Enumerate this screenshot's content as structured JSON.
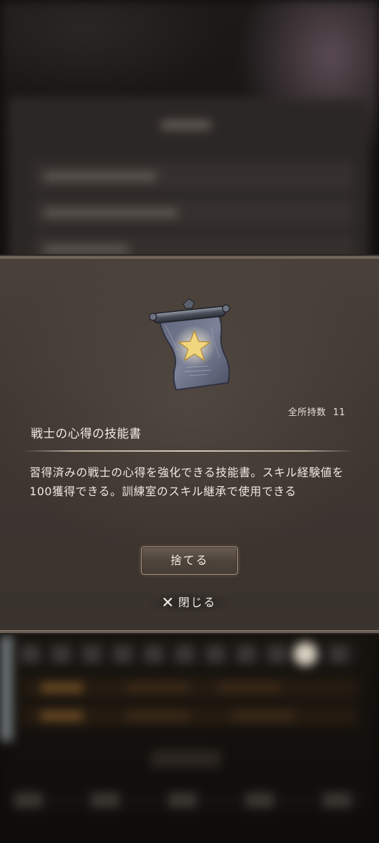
{
  "dialog": {
    "item_name": "戦士の心得の技能書",
    "owned_label": "全所持数",
    "owned_count": "11",
    "description": "習得済みの戦士の心得を強化できる技能書。スキル経験値を100獲得できる。訓練室のスキル継承で使用できる",
    "discard_label": "捨てる",
    "close_label": "閉じる",
    "icon": "scroll-star-icon",
    "close_icon": "close-icon"
  }
}
